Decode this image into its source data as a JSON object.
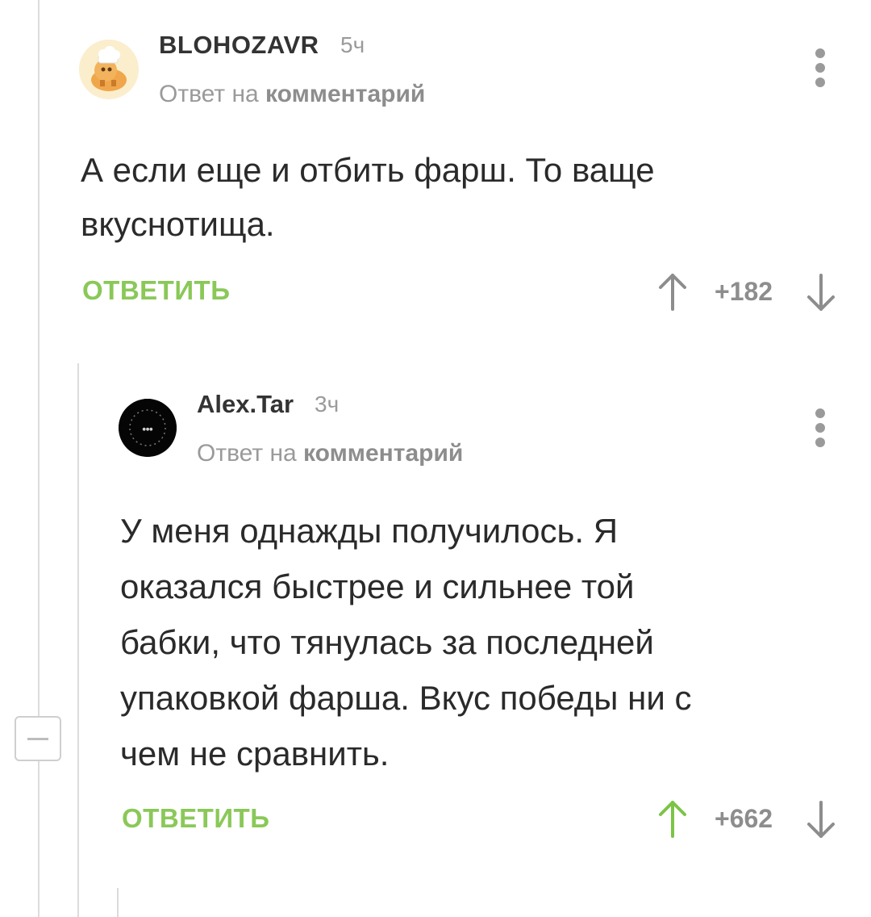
{
  "comments": [
    {
      "username": "BLOHOZAVR",
      "time": "5ч",
      "reply_prefix": "Ответ на",
      "reply_target": "комментарий",
      "text_lines": [
        "А если еще и отбить фарш. То ваще",
        "вкуснотища."
      ],
      "reply_label": "ОТВЕТИТЬ",
      "rating": "+182",
      "upvoted": false
    },
    {
      "username": "Alex.Tar",
      "time": "3ч",
      "reply_prefix": "Ответ на",
      "reply_target": "комментарий",
      "text_lines": [
        "У меня однажды получилось. Я",
        "оказался быстрее и сильнее той",
        "бабки, что тянулась за последней",
        "упаковкой фарша. Вкус победы ни с",
        "чем не сравнить."
      ],
      "reply_label": "ОТВЕТИТЬ",
      "rating": "+662",
      "upvoted": true
    }
  ],
  "colors": {
    "accent": "#8ac858",
    "muted": "#9a9a9a",
    "thread": "#dcdcdc"
  },
  "icons": [
    "avatar-dino-icon",
    "avatar-dark-icon",
    "more-icon",
    "upvote-icon",
    "downvote-icon",
    "collapse-icon"
  ]
}
